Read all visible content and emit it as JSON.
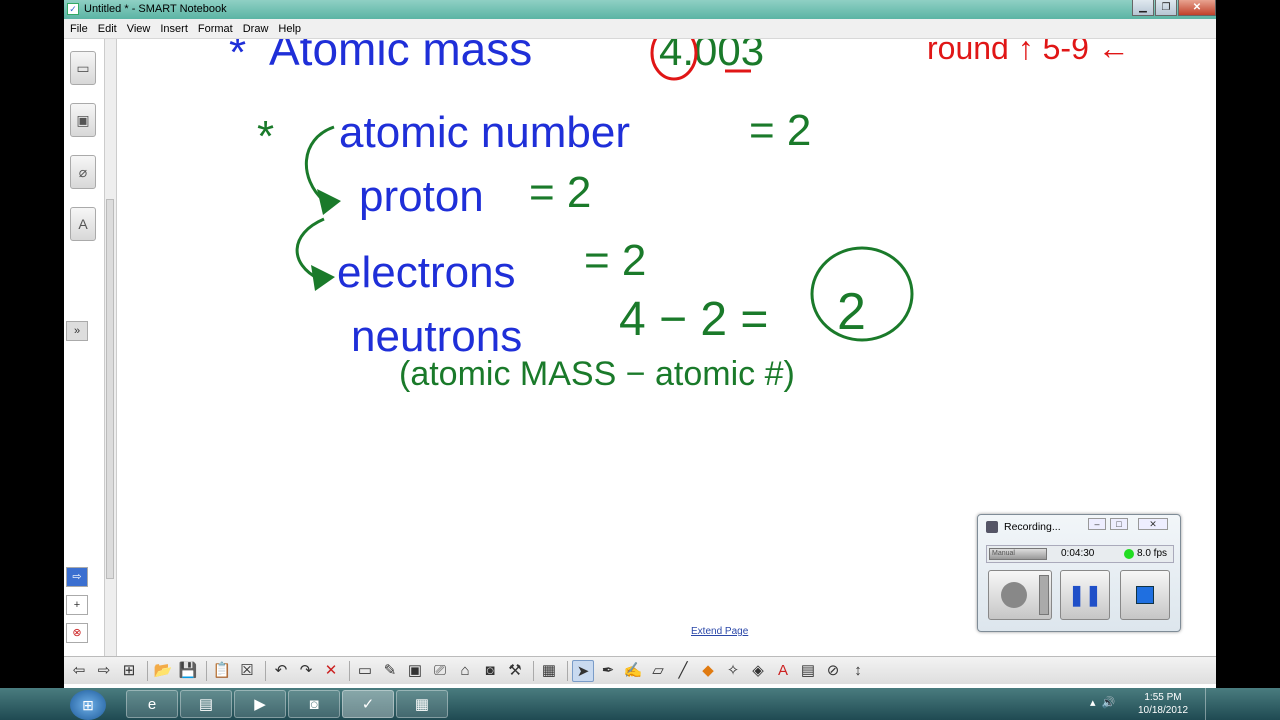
{
  "window": {
    "title": "Untitled * - SMART Notebook",
    "app_icon": "notebook-icon",
    "buttons": [
      "minimize",
      "maximize",
      "close"
    ]
  },
  "menu": [
    "File",
    "Edit",
    "View",
    "Insert",
    "Format",
    "Draw",
    "Help"
  ],
  "side_tabs": {
    "icons": [
      "page-sorter-icon",
      "gallery-icon",
      "attachments-icon",
      "properties-icon"
    ],
    "buttons": [
      "expand-panel-icon",
      "collapse-icon"
    ]
  },
  "canvas": {
    "extend_page": "Extend Page",
    "handwriting": {
      "line1_blue": "Atomic mass",
      "line1_value": "4.003",
      "line1_note": "round ↑ 5-9 ←",
      "line2_label": "atomic number",
      "line2_value": "= 2",
      "line3_label": "proton",
      "line3_value": "= 2",
      "line4_label": "electrons",
      "line4_value": "= 2",
      "line5_label": "neutrons",
      "line5_value": "4 − 2 =",
      "line5_answer": "2",
      "line6_note": "(atomic MASS − atomic #)"
    },
    "colors": {
      "blue_ink": "#1f2fd8",
      "green_ink": "#1a7a2a",
      "red_ink": "#e01616"
    }
  },
  "toolbar": {
    "tools": [
      "back-icon",
      "forward-icon",
      "add-page-icon",
      "open-icon",
      "save-icon",
      "paste-icon",
      "delete-page-icon",
      "undo-icon",
      "redo-icon",
      "delete-icon",
      "screen-shade-icon",
      "pens-icon",
      "display-icon",
      "screen-capture-icon",
      "document-camera-icon",
      "table-icon",
      "select-icon",
      "pen-icon",
      "creative-pen-icon",
      "eraser-icon",
      "line-icon",
      "shapes-icon",
      "magic-pen-icon",
      "fill-icon",
      "text-icon",
      "properties-icon",
      "measurement-icon",
      "move-toolbar-icon"
    ]
  },
  "recorder": {
    "title": "Recording...",
    "mode": "Manual",
    "time": "0:04:30",
    "fps": "8.0 fps",
    "buttons": [
      "record-button",
      "pause-button",
      "stop-button"
    ]
  },
  "taskbar": {
    "time": "1:55 PM",
    "date": "10/18/2012"
  }
}
